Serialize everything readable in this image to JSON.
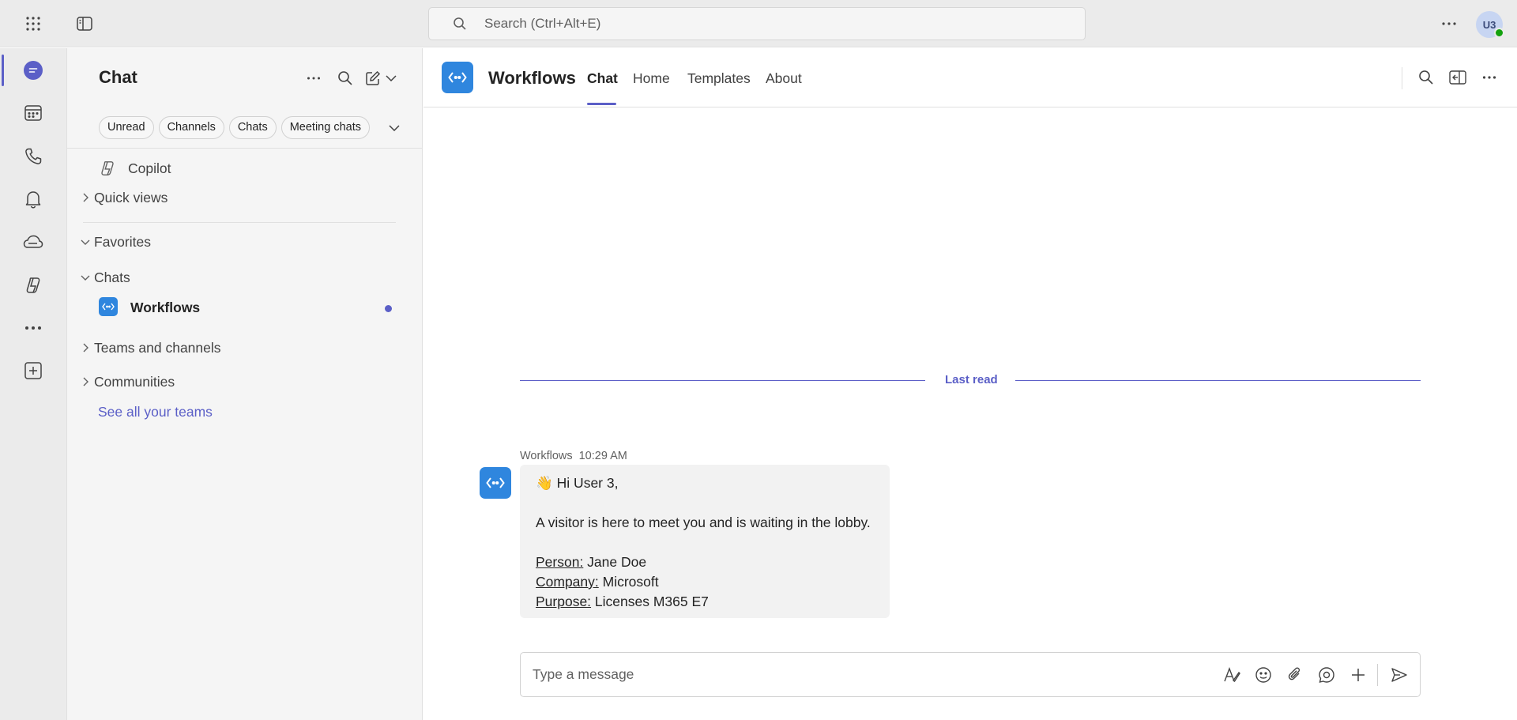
{
  "topbar": {
    "search_placeholder": "Search (Ctrl+Alt+E)",
    "avatar_initials": "U3"
  },
  "rail": {
    "items": [
      "chat-icon",
      "calendar-icon",
      "calls-icon",
      "activity-icon",
      "onedrive-icon",
      "copilot-icon",
      "more-apps-icon",
      "add-app-icon"
    ]
  },
  "leftpane": {
    "title": "Chat",
    "filters": [
      "Unread",
      "Channels",
      "Chats",
      "Meeting chats"
    ],
    "copilot_label": "Copilot",
    "quick_views_label": "Quick views",
    "favorites_label": "Favorites",
    "chats_label": "Chats",
    "chat_item_name": "Workflows",
    "teams_label": "Teams and channels",
    "communities_label": "Communities",
    "see_all_label": "See all your teams"
  },
  "main": {
    "app_name": "Workflows",
    "tabs": [
      "Chat",
      "Home",
      "Templates",
      "About"
    ],
    "last_read_label": "Last read",
    "message": {
      "sender": "Workflows",
      "time": "10:29 AM",
      "greeting": "Hi User 3,",
      "body": "A visitor is here to meet you and is waiting in the lobby.",
      "person_label": "Person:",
      "person_value": " Jane Doe",
      "company_label": "Company:",
      "company_value": " Microsoft",
      "purpose_label": "Purpose:",
      "purpose_value": " Licenses M365 E7"
    },
    "compose_placeholder": "Type a message"
  },
  "colors": {
    "accent": "#5b5fc7",
    "workflows_icon": "#2f86de",
    "presence": "#13a10e"
  }
}
